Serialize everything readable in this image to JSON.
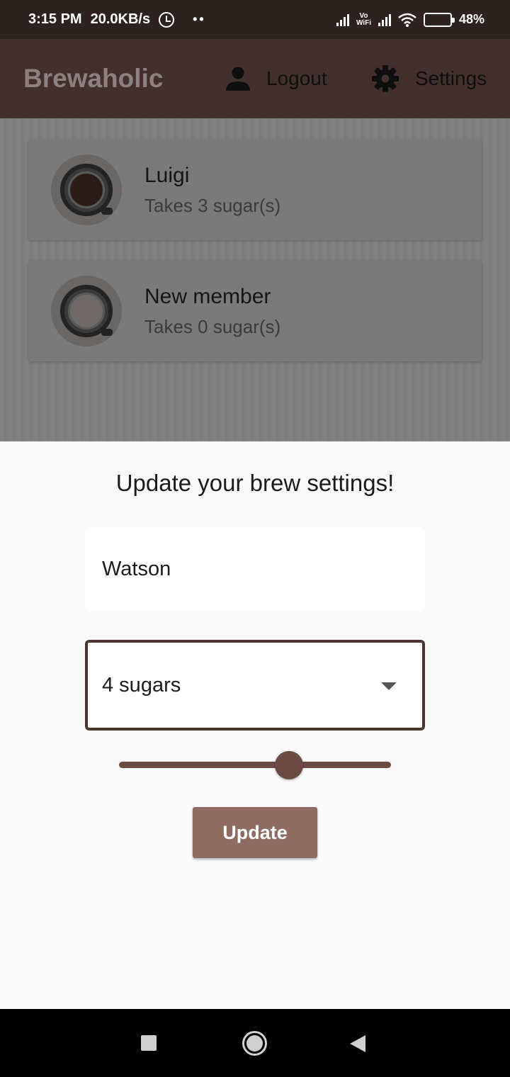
{
  "status_bar": {
    "time": "3:15 PM",
    "speed": "20.0KB/s",
    "dots": "••",
    "vowifi_top": "Vo",
    "vowifi_bottom": "WiFi",
    "battery": "48%"
  },
  "app_bar": {
    "title": "Brewaholic",
    "logout_label": "Logout",
    "settings_label": "Settings"
  },
  "members": [
    {
      "name": "Luigi",
      "sugars_text": "Takes 3 sugar(s)"
    },
    {
      "name": "New member",
      "sugars_text": "Takes 0 sugar(s)"
    }
  ],
  "sheet": {
    "title": "Update your brew settings!",
    "name_value": "Watson",
    "sugars_selected": "4 sugars",
    "strength_level_fraction": 0.625,
    "update_label": "Update"
  },
  "colors": {
    "app_bar": "#43302c",
    "accent_brown": "#6b4b41",
    "button": "#8e6c62"
  },
  "icons": {
    "logout": "person-icon",
    "settings": "gear-icon",
    "nav_recents": "square-icon",
    "nav_home": "circle-icon",
    "nav_back": "triangle-back-icon"
  }
}
